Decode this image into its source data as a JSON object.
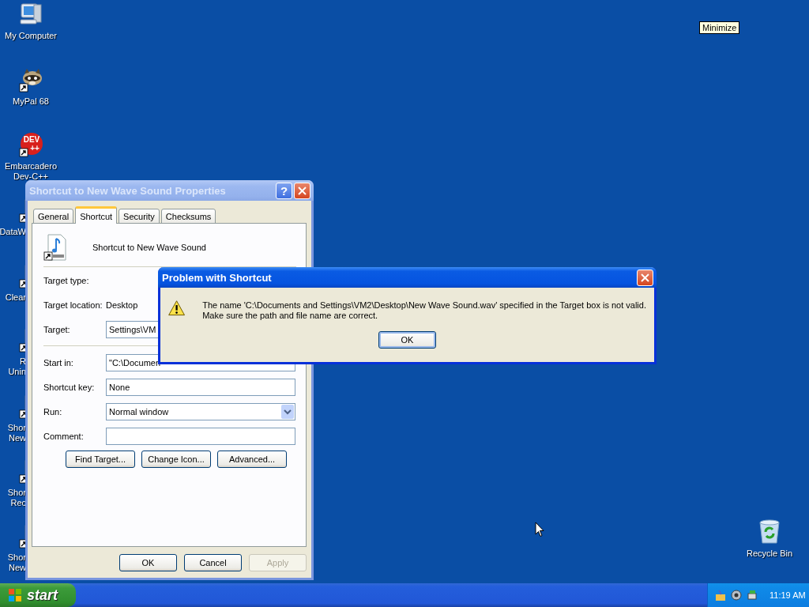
{
  "desktop": {
    "icons": [
      {
        "kind": "computer",
        "lines": [
          "My Computer"
        ]
      },
      {
        "kind": "raccoon",
        "lines": [
          "MyPal 68"
        ]
      },
      {
        "kind": "dev",
        "lines": [
          "Embarcadero",
          "Dev-C++"
        ],
        "logo": [
          "DEV",
          "++"
        ]
      },
      {
        "kind": "generic",
        "lines": [
          "DataW"
        ]
      },
      {
        "kind": "generic",
        "lines": [
          "Clear"
        ]
      },
      {
        "kind": "generic",
        "lines": [
          "R",
          "Unin"
        ]
      },
      {
        "kind": "generic",
        "lines": [
          "Shor",
          "New"
        ]
      },
      {
        "kind": "generic",
        "lines": [
          "Shor",
          "Rec"
        ]
      },
      {
        "kind": "generic",
        "lines": [
          "Shor",
          "New"
        ]
      }
    ],
    "recycle_bin": {
      "label": "Recycle Bin"
    },
    "tooltip": "Minimize"
  },
  "properties_window": {
    "title": "Shortcut to New Wave Sound Properties",
    "help_button": "?",
    "tabs": [
      {
        "label": "General",
        "selected": false
      },
      {
        "label": "Shortcut",
        "selected": true
      },
      {
        "label": "Security",
        "selected": false
      },
      {
        "label": "Checksums",
        "selected": false
      }
    ],
    "file_name": "Shortcut to New Wave Sound",
    "target_rows": [
      {
        "kind": "info",
        "label": "Target type:"
      },
      {
        "kind": "info",
        "label": "Target location:",
        "value": "Desktop"
      },
      {
        "kind": "text",
        "label": "Target:",
        "value": "Settings\\VM"
      }
    ],
    "start_rows": [
      {
        "kind": "text",
        "label": "Start in:",
        "value": "\"C:\\Documen"
      },
      {
        "kind": "text",
        "label": "Shortcut key:",
        "value": "None"
      },
      {
        "kind": "select",
        "label": "Run:",
        "value": "Normal window"
      },
      {
        "kind": "text",
        "label": "Comment:"
      }
    ],
    "buttons": [
      "Find Target...",
      "Change Icon...",
      "Advanced..."
    ],
    "footer_buttons": [
      {
        "label": "OK",
        "disabled": false
      },
      {
        "label": "Cancel",
        "disabled": false
      },
      {
        "label": "Apply",
        "disabled": true
      }
    ]
  },
  "error_dialog": {
    "title": "Problem with Shortcut",
    "message": "The name 'C:\\Documents and Settings\\VM2\\Desktop\\New Wave Sound.wav' specified in the Target box is not valid.\nMake sure the path and file name are correct.",
    "button": "OK"
  },
  "taskbar": {
    "start": "start",
    "clock": "11:19 AM"
  }
}
